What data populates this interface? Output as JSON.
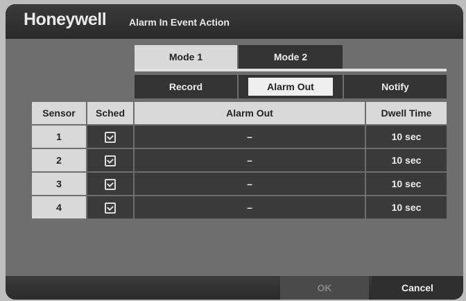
{
  "header": {
    "brand": "Honeywell",
    "title": "Alarm In Event Action"
  },
  "mode_tabs": [
    {
      "label": "Mode 1"
    },
    {
      "label": "Mode 2"
    }
  ],
  "sub_tabs": [
    {
      "label": "Record"
    },
    {
      "label": "Alarm Out"
    },
    {
      "label": "Notify"
    }
  ],
  "table": {
    "columns": [
      "Sensor",
      "Sched",
      "Alarm Out",
      "Dwell Time"
    ],
    "rows": [
      {
        "sensor": "1",
        "alarm_out": "–",
        "dwell": "10 sec"
      },
      {
        "sensor": "2",
        "alarm_out": "–",
        "dwell": "10 sec"
      },
      {
        "sensor": "3",
        "alarm_out": "–",
        "dwell": "10 sec"
      },
      {
        "sensor": "4",
        "alarm_out": "–",
        "dwell": "10 sec"
      }
    ]
  },
  "buttons": {
    "ok": "OK",
    "cancel": "Cancel"
  }
}
